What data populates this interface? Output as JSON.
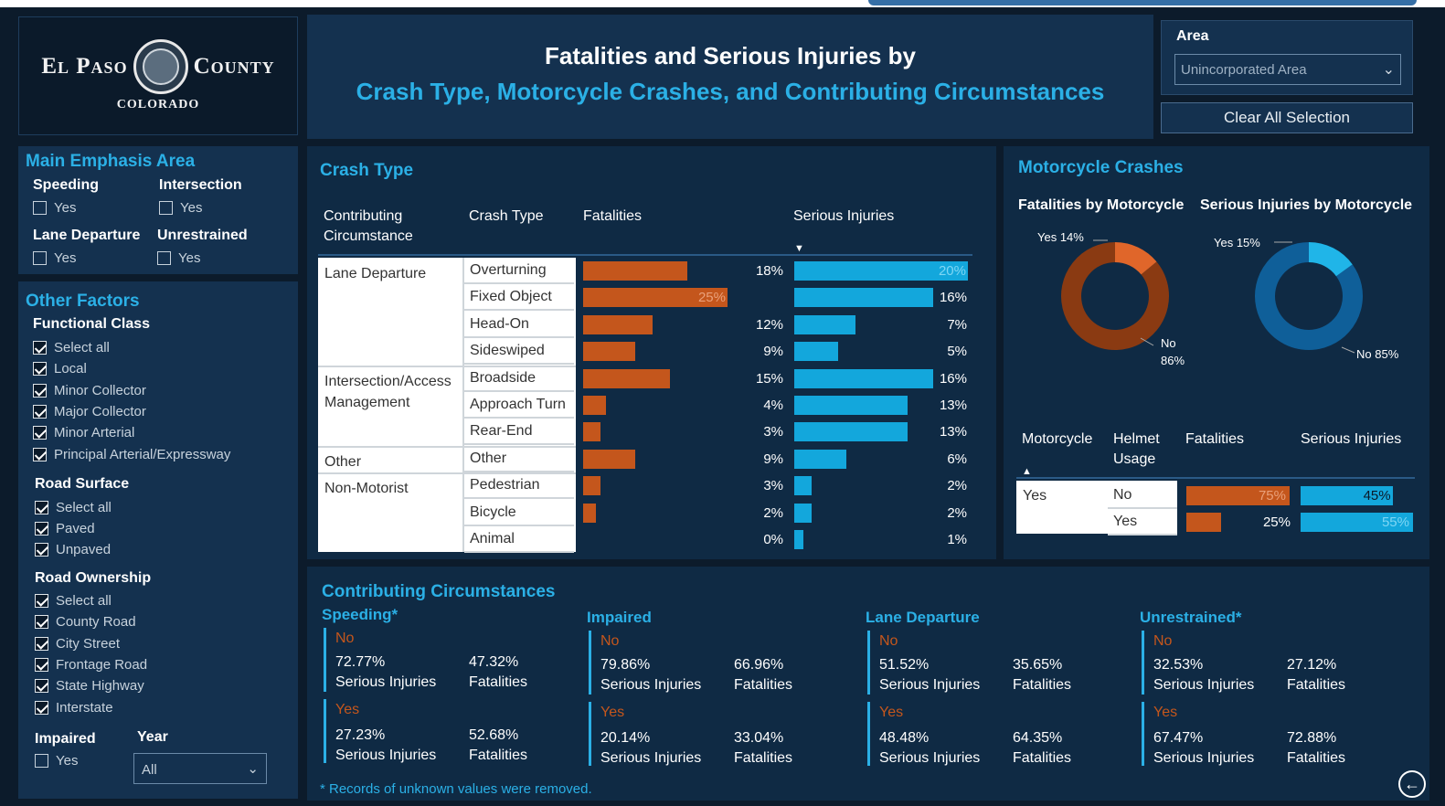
{
  "logo": {
    "left": "El Paso",
    "right": "County",
    "sub": "COLORADO"
  },
  "header": {
    "line1": "Fatalities and Serious Injuries by",
    "line2": "Crash Type, Motorcycle Crashes, and Contributing Circumstances"
  },
  "area": {
    "label": "Area",
    "value": "Unincorporated Area"
  },
  "clear_label": "Clear All Selection",
  "main_emphasis": {
    "title": "Main Emphasis Area",
    "groups": [
      {
        "name": "Speeding",
        "option": "Yes"
      },
      {
        "name": "Intersection",
        "option": "Yes"
      },
      {
        "name": "Lane Departure",
        "option": "Yes"
      },
      {
        "name": "Unrestrained",
        "option": "Yes"
      }
    ]
  },
  "other_factors": {
    "title": "Other Factors",
    "functional_class": {
      "title": "Functional Class",
      "items": [
        "Select all",
        "Local",
        "Minor Collector",
        "Major Collector",
        "Minor Arterial",
        "Principal Arterial/Expressway"
      ]
    },
    "road_surface": {
      "title": "Road Surface",
      "items": [
        "Select all",
        "Paved",
        "Unpaved"
      ]
    },
    "road_ownership": {
      "title": "Road Ownership",
      "items": [
        "Select all",
        "County Road",
        "City Street",
        "Frontage Road",
        "State Highway",
        "Interstate"
      ]
    },
    "impaired": {
      "title": "Impaired",
      "option": "Yes"
    },
    "year": {
      "title": "Year",
      "value": "All"
    }
  },
  "crash_type": {
    "title": "Crash Type",
    "columns": {
      "circ": "Contributing Circumstance",
      "type": "Crash Type",
      "fat": "Fatalities",
      "ser": "Serious Injuries"
    },
    "groups": [
      {
        "name": "Lane Departure",
        "rows": 4
      },
      {
        "name": "Intersection/Access Management",
        "rows": 3
      },
      {
        "name": "Other",
        "rows": 1
      },
      {
        "name": "Non-Motorist",
        "rows": 3
      }
    ],
    "rows": [
      {
        "type": "Overturning",
        "fat": 18,
        "ser": 20,
        "fat_label": "18%",
        "ser_label": "20%"
      },
      {
        "type": "Fixed Object",
        "fat": 25,
        "ser": 16,
        "fat_label": "25%",
        "ser_label": "16%"
      },
      {
        "type": "Head-On",
        "fat": 12,
        "ser": 7,
        "fat_label": "12%",
        "ser_label": "7%"
      },
      {
        "type": "Sideswiped",
        "fat": 9,
        "ser": 5,
        "fat_label": "9%",
        "ser_label": "5%"
      },
      {
        "type": "Broadside",
        "fat": 15,
        "ser": 16,
        "fat_label": "15%",
        "ser_label": "16%"
      },
      {
        "type": "Approach Turn",
        "fat": 4,
        "ser": 13,
        "fat_label": "4%",
        "ser_label": "13%"
      },
      {
        "type": "Rear-End",
        "fat": 3,
        "ser": 13,
        "fat_label": "3%",
        "ser_label": "13%"
      },
      {
        "type": "Other",
        "fat": 9,
        "ser": 6,
        "fat_label": "9%",
        "ser_label": "6%"
      },
      {
        "type": "Pedestrian",
        "fat": 3,
        "ser": 2,
        "fat_label": "3%",
        "ser_label": "2%"
      },
      {
        "type": "Bicycle",
        "fat": 2,
        "ser": 2,
        "fat_label": "2%",
        "ser_label": "2%"
      },
      {
        "type": "Animal",
        "fat": 0,
        "ser": 1,
        "fat_label": "0%",
        "ser_label": "1%"
      }
    ]
  },
  "motorcycle": {
    "title": "Motorcycle Crashes",
    "fat_title": "Fatalities by Motorcycle",
    "ser_title": "Serious Injuries by Motorcycle",
    "fat_yes": 14,
    "fat_no": 86,
    "fat_yes_label": "Yes 14%",
    "fat_no_label": "No",
    "fat_no_pct": "86%",
    "ser_yes": 15,
    "ser_no": 85,
    "ser_yes_label": "Yes 15%",
    "ser_no_label": "No 85%",
    "columns": {
      "moto": "Motorcycle",
      "helmet": "Helmet Usage",
      "fat": "Fatalities",
      "ser": "Serious Injuries"
    },
    "moto_value": "Yes",
    "rows": [
      {
        "helmet": "No",
        "fat": 75,
        "ser": 45,
        "fat_label": "75%",
        "ser_label": "45%"
      },
      {
        "helmet": "Yes",
        "fat": 25,
        "ser": 55,
        "fat_label": "25%",
        "ser_label": "55%"
      }
    ]
  },
  "contrib": {
    "title": "Contributing Circumstances",
    "groups": [
      {
        "name": "Speeding*",
        "no_label": "No",
        "yes_label": "Yes",
        "no_ser": "72.77%",
        "no_fat": "47.32%",
        "yes_ser": "27.23%",
        "yes_fat": "52.68%"
      },
      {
        "name": "Impaired",
        "no_label": "No",
        "yes_label": "Yes",
        "no_ser": "79.86%",
        "no_fat": "66.96%",
        "yes_ser": "20.14%",
        "yes_fat": "33.04%"
      },
      {
        "name": "Lane Departure",
        "no_label": "No",
        "yes_label": "Yes",
        "no_ser": "51.52%",
        "no_fat": "35.65%",
        "yes_ser": "48.48%",
        "yes_fat": "64.35%"
      },
      {
        "name": "Unrestrained*",
        "no_label": "No",
        "yes_label": "Yes",
        "no_ser": "32.53%",
        "no_fat": "27.12%",
        "yes_ser": "67.47%",
        "yes_fat": "72.88%"
      }
    ],
    "ser_label": "Serious Injuries",
    "fat_label": "Fatalities",
    "footnote": "* Records of unknown values were removed."
  }
}
